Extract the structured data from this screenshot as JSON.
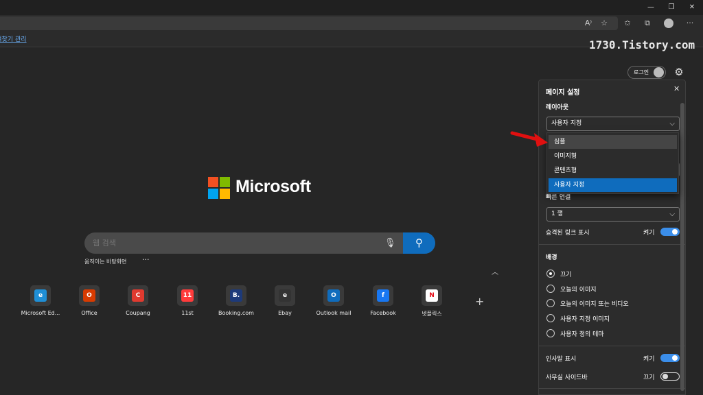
{
  "browser": {
    "favorites_link": "즐겨찾기 관리",
    "window_buttons": [
      "—",
      "❐",
      "✕"
    ],
    "toolbar_icons": [
      "read-aloud-icon",
      "add-favorite-icon",
      "favorites-icon",
      "collections-icon",
      "profile-icon",
      "more-icon"
    ]
  },
  "watermark": "1730.Tistory.com",
  "header": {
    "login_label": "로그인"
  },
  "logo": {
    "title": "Microsoft",
    "colors": [
      "#f25022",
      "#7fba00",
      "#00a4ef",
      "#ffb900"
    ]
  },
  "search": {
    "placeholder": "웹 검색",
    "background_link": "움직이는 바탕화면",
    "more": "···"
  },
  "quick_links": [
    {
      "label": "Microsoft Ed...",
      "glyph": "e",
      "color": "#1f8fd6"
    },
    {
      "label": "Office",
      "glyph": "O",
      "color": "#d83b01"
    },
    {
      "label": "Coupang",
      "glyph": "C",
      "color": "#e03a2f"
    },
    {
      "label": "11st",
      "glyph": "11",
      "color": "#ff3b3b"
    },
    {
      "label": "Booking.com",
      "glyph": "B.",
      "color": "#1d3a7a"
    },
    {
      "label": "Ebay",
      "glyph": "e",
      "color": "#333333"
    },
    {
      "label": "Outlook mail",
      "glyph": "O",
      "color": "#0f6cbd"
    },
    {
      "label": "Facebook",
      "glyph": "f",
      "color": "#1877f2"
    },
    {
      "label": "넷플릭스",
      "glyph": "N",
      "color": "#1a1a1a"
    }
  ],
  "settings_panel": {
    "title": "페이지 설정",
    "layout": {
      "heading": "레이아웃",
      "selected": "사용자 지정",
      "options": [
        "심플",
        "이미지형",
        "콘텐츠형",
        "사용자 지정"
      ]
    },
    "quick_links": {
      "heading": "빠른 연결",
      "selected": "1 행"
    },
    "promoted_links": {
      "label": "승격된 링크 표시",
      "state": "켜기",
      "on": true
    },
    "background": {
      "heading": "배경",
      "options": [
        "끄기",
        "오늘의 이미지",
        "오늘의 이미지 또는 비디오",
        "사용자 지정 이미지",
        "사용자 정의 테마"
      ],
      "checked_index": 0
    },
    "greeting": {
      "label": "인사말 표시",
      "state": "켜기",
      "on": true
    },
    "office_sidebar": {
      "label": "사무실 사이드바",
      "state": "끄기",
      "on": false
    }
  }
}
